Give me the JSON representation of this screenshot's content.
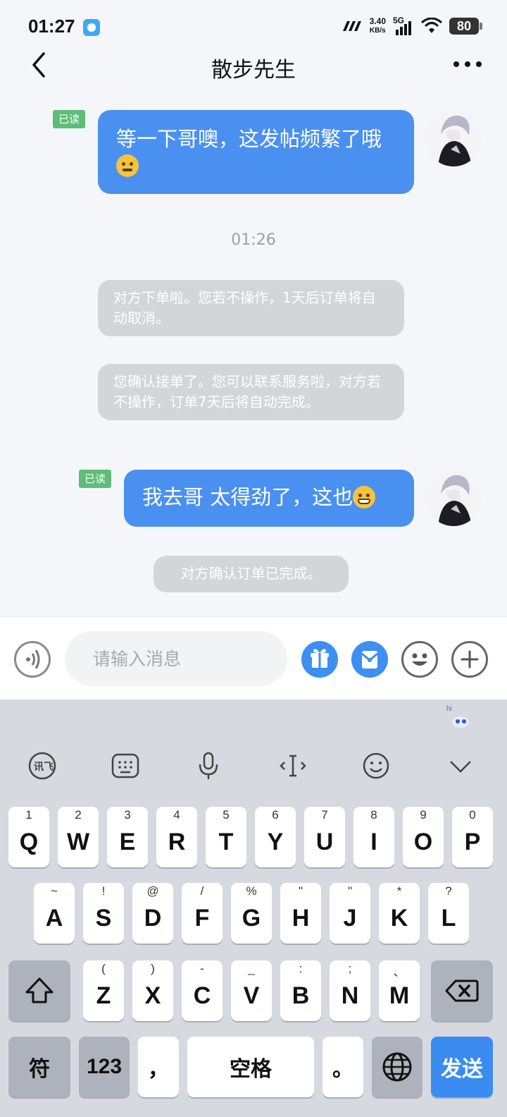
{
  "status_bar": {
    "time": "01:27",
    "net_speed_value": "3.40",
    "net_speed_unit": "KB/s",
    "network": "5G",
    "battery": "80"
  },
  "nav": {
    "title": "散步先生"
  },
  "chat": {
    "messages": [
      {
        "read": "已读",
        "text": "等一下哥噢，这发帖频繁了哦",
        "emoji": "angry-emoji"
      },
      {
        "timestamp": "01:26"
      },
      {
        "system": "对方下单啦。您若不操作，1天后订单将自动取消。"
      },
      {
        "system": "您确认接单了。您可以联系服务啦，对方若不操作，订单7天后将自动完成。"
      },
      {
        "read": "已读",
        "text": "我去哥 太得劲了，这也",
        "emoji": "grin-emoji"
      },
      {
        "system": "对方确认订单已完成。"
      }
    ]
  },
  "input_bar": {
    "placeholder": "请输入消息"
  },
  "keyboard": {
    "row1": [
      {
        "main": "Q",
        "sub": "1"
      },
      {
        "main": "W",
        "sub": "2"
      },
      {
        "main": "E",
        "sub": "3"
      },
      {
        "main": "R",
        "sub": "4"
      },
      {
        "main": "T",
        "sub": "5"
      },
      {
        "main": "Y",
        "sub": "6"
      },
      {
        "main": "U",
        "sub": "7"
      },
      {
        "main": "I",
        "sub": "8"
      },
      {
        "main": "O",
        "sub": "9"
      },
      {
        "main": "P",
        "sub": "0"
      }
    ],
    "row2": [
      {
        "main": "A",
        "sub": "~"
      },
      {
        "main": "S",
        "sub": "!"
      },
      {
        "main": "D",
        "sub": "@"
      },
      {
        "main": "F",
        "sub": "/"
      },
      {
        "main": "G",
        "sub": "%"
      },
      {
        "main": "H",
        "sub": "\""
      },
      {
        "main": "J",
        "sub": "\""
      },
      {
        "main": "K",
        "sub": "*"
      },
      {
        "main": "L",
        "sub": "?"
      }
    ],
    "row3": [
      {
        "main": "Z",
        "sub": "("
      },
      {
        "main": "X",
        "sub": ")"
      },
      {
        "main": "C",
        "sub": "-"
      },
      {
        "main": "V",
        "sub": "_"
      },
      {
        "main": "B",
        "sub": ":"
      },
      {
        "main": "N",
        "sub": ";"
      },
      {
        "main": "M",
        "sub": "、"
      }
    ],
    "symbols": "符",
    "numbers": "123",
    "comma": "，",
    "space": "空格",
    "period": "。",
    "send": "发送"
  },
  "colors": {
    "accent": "#4a90f0",
    "read_badge": "#5bbf76",
    "system_bubble": "#d3d5d9",
    "send_key": "#3a8cf1"
  }
}
